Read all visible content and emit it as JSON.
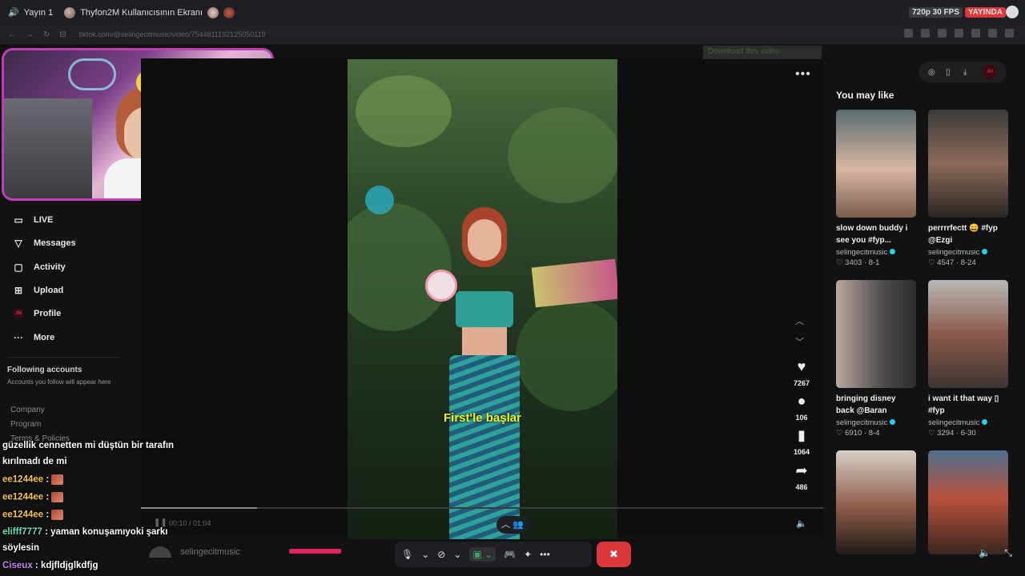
{
  "discord": {
    "channel": "Yayın 1",
    "screen_title": "Thyfon2M Kullanıcısının Ekranı",
    "quality": "720p 30 FPS",
    "live": "YAYINDA"
  },
  "browser": {
    "url": "tiktok.com/@selingecitmusic/video/7544811192125050119"
  },
  "extension": {
    "label": "Download this video"
  },
  "sidebar": {
    "items": [
      {
        "label": "LIVE",
        "icon": "live-icon"
      },
      {
        "label": "Messages",
        "icon": "messages-icon"
      },
      {
        "label": "Activity",
        "icon": "activity-icon"
      },
      {
        "label": "Upload",
        "icon": "upload-icon"
      },
      {
        "label": "Profile",
        "icon": "profile-icon"
      },
      {
        "label": "More",
        "icon": "more-icon"
      }
    ],
    "following_title": "Following accounts",
    "following_sub": "Accounts you follow will appear here",
    "footer": [
      "Company",
      "Program",
      "Terms & Policies"
    ]
  },
  "video": {
    "caption": "First'le başlar",
    "likes": "7267",
    "comments": "106",
    "saves": "1064",
    "shares": "486",
    "time": "00:10 / 01:04",
    "author": "selingecitmusic",
    "progress": 0.17
  },
  "recommendations": {
    "title": "You may like",
    "items": [
      {
        "caption": "slow down buddy i see you #fyp...",
        "author": "selingecitmusic",
        "stats": "♡ 3403 · 8-1"
      },
      {
        "caption": "perrrrfectt 😄 #fyp @Ezgi",
        "author": "selingecitmusic",
        "stats": "♡ 4547 · 8-24"
      },
      {
        "caption": "bringing disney back @Baran Mengüç ...",
        "author": "selingecitmusic",
        "stats": "♡ 6910 · 8-4"
      },
      {
        "caption": "i want it that way ▯ #fyp",
        "author": "selingecitmusic",
        "stats": "♡ 3294 · 6-30"
      },
      {
        "caption": "",
        "author": "",
        "stats": ""
      },
      {
        "caption": "",
        "author": "",
        "stats": ""
      }
    ]
  },
  "chat": [
    {
      "user": "",
      "message": "güzellik cennetten mi düştün bir tarafın"
    },
    {
      "user": "",
      "message": "kırılmadı de mi"
    },
    {
      "user": "ee1244ee",
      "message": ":",
      "emote": true
    },
    {
      "user": "ee1244ee",
      "message": ":",
      "emote": true
    },
    {
      "user": "ee1244ee",
      "message": ":",
      "emote": true
    },
    {
      "user": "elifff7777",
      "message": ": yaman konuşamıyoki şarkı"
    },
    {
      "user": "",
      "message": "söylesin"
    },
    {
      "user": "Ciseux",
      "message": ": kdjfldjglkdfjg"
    }
  ]
}
